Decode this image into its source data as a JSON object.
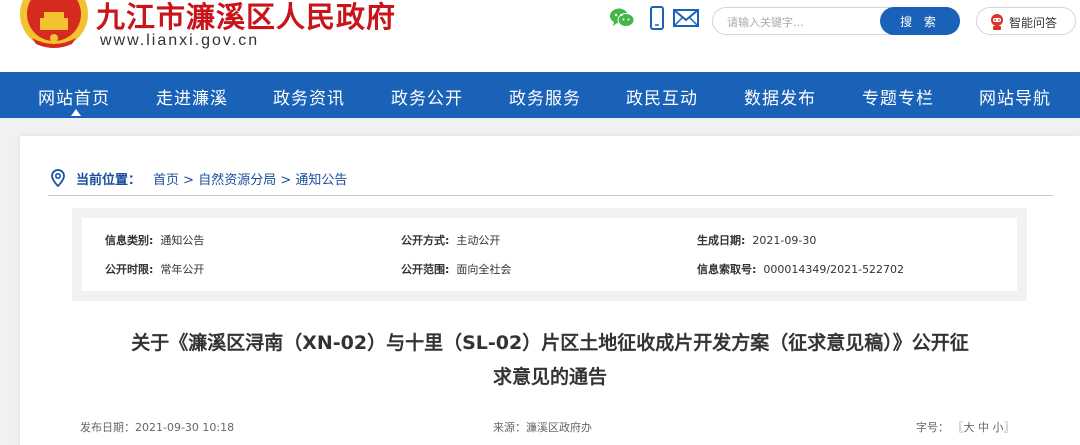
{
  "header": {
    "site_title": "九江市濂溪区人民政府",
    "site_url": "www.lianxi.gov.cn",
    "icons": [
      "wechat-icon",
      "mobile-icon",
      "mail-icon"
    ],
    "search": {
      "placeholder": "请输入关键字...",
      "button_label": "搜 索"
    },
    "ai_button_label": "智能问答"
  },
  "nav": {
    "items": [
      {
        "label": "网站首页",
        "active": true
      },
      {
        "label": "走进濂溪"
      },
      {
        "label": "政务资讯"
      },
      {
        "label": "政务公开"
      },
      {
        "label": "政务服务"
      },
      {
        "label": "政民互动"
      },
      {
        "label": "数据发布"
      },
      {
        "label": "专题专栏"
      },
      {
        "label": "网站导航"
      }
    ]
  },
  "breadcrumb": {
    "label": "当前位置：",
    "items": [
      "首页",
      "自然资源分局",
      "通知公告"
    ],
    "separator": " > "
  },
  "info": {
    "category_label": "信息类别:",
    "category_value": "通知公告",
    "method_label": "公开方式:",
    "method_value": "主动公开",
    "generated_label": "生成日期:",
    "generated_value": "2021-09-30",
    "period_label": "公开时限:",
    "period_value": "常年公开",
    "scope_label": "公开范围:",
    "scope_value": "面向全社会",
    "index_label": "信息索取号:",
    "index_value": "000014349/2021-522702"
  },
  "article": {
    "title_line1": "关于《濂溪区浔南（XN-02）与十里（SL-02）片区土地征收成片开发方案（征求意见稿）》公开征",
    "title_line2": "求意见的通告",
    "publish_date": "发布日期：2021-09-30 10:18",
    "source": "来源：濂溪区政府办",
    "font_size_label": "字号：",
    "font_open": "〖",
    "font_large": "大",
    "font_medium": "中",
    "font_small": "小",
    "font_close": "〗"
  },
  "colors": {
    "title_red": "#c8141a",
    "nav_blue": "#1a62b8",
    "link_blue": "#1a4fa0",
    "emblem_gold": "#f2c230",
    "wechat_green": "#44b549"
  }
}
